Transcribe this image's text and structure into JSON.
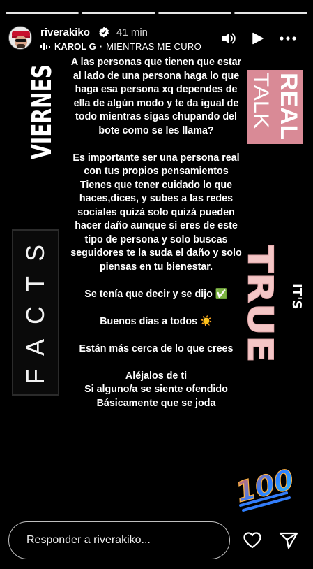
{
  "progress": {
    "segments": 4,
    "current_index": 3
  },
  "header": {
    "username": "riverakiko",
    "time": "41 min",
    "music_artist": "KAROL G",
    "music_separator": "·",
    "music_track": "MIENTRAS ME CURO",
    "icons": [
      "verified-badge-icon",
      "sound-on-icon",
      "play-icon",
      "more-options-icon"
    ]
  },
  "stickers": {
    "viernes": "VIERNES",
    "real_talk_line1": "REAL",
    "real_talk_line2": "TALK",
    "facts": "FACTS",
    "its": "IT'S",
    "true": "TRUE",
    "hundred": "100"
  },
  "story": {
    "paragraph1": "A las personas que tienen que estar al lado de una persona haga lo que haga esa persona xq dependes de ella de algún modo y te da igual de todo mientras sigas chupando del bote como se les llama?",
    "paragraph2": "Es importante ser una persona real con tus propios pensamientos Tienes que tener cuidado lo que haces,dices, y subes a las redes sociales quizá solo quizá pueden hacer daño aunque si eres de este tipo de persona y solo buscas seguidores  te la suda el daño y solo piensas en tu bienestar.",
    "paragraph3": "Se tenía que decir y se dijo ✅",
    "paragraph4": "Buenos  días a todos ☀️",
    "paragraph5": "Están más cerca de lo que crees",
    "paragraph6_line1": "Aléjalos de ti",
    "paragraph6_line2": "Si alguno/a se siente ofendido",
    "paragraph6_line3": "Básicamente que se joda"
  },
  "footer": {
    "reply_placeholder": "Responder a riverakiko...",
    "icons": [
      "heart-icon",
      "send-icon"
    ]
  },
  "colors": {
    "background": "#000000",
    "real_talk_bg": "#d98a96",
    "its_true_pink": "#f4c6c6",
    "text": "#ffffff"
  }
}
